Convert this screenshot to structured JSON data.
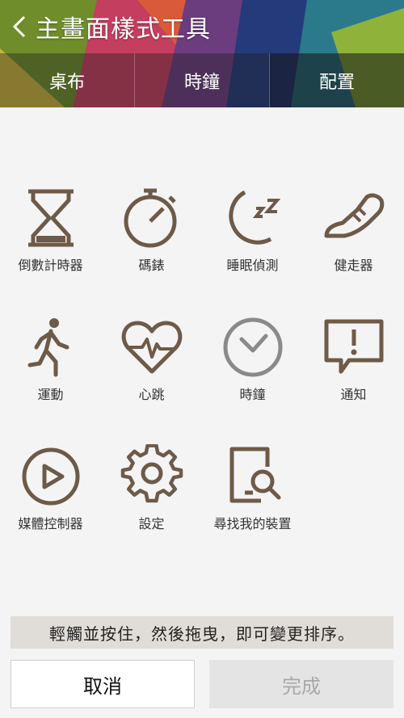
{
  "header": {
    "title": "主畫面樣式工具"
  },
  "tabs": [
    {
      "label": "桌布"
    },
    {
      "label": "時鐘"
    },
    {
      "label": "配置"
    }
  ],
  "widgets": [
    {
      "label": "倒數計時器",
      "icon": "hourglass-icon"
    },
    {
      "label": "碼錶",
      "icon": "stopwatch-icon"
    },
    {
      "label": "睡眠偵測",
      "icon": "moon-sleep-icon"
    },
    {
      "label": "健走器",
      "icon": "sneaker-icon"
    },
    {
      "label": "運動",
      "icon": "runner-icon"
    },
    {
      "label": "心跳",
      "icon": "heart-rate-icon"
    },
    {
      "label": "時鐘",
      "icon": "clock-icon"
    },
    {
      "label": "通知",
      "icon": "notification-icon"
    },
    {
      "label": "媒體控制器",
      "icon": "play-icon"
    },
    {
      "label": "設定",
      "icon": "gear-icon"
    },
    {
      "label": "尋找我的裝置",
      "icon": "find-device-icon"
    }
  ],
  "hint": "輕觸並按住，然後拖曳，即可變更排序。",
  "buttons": {
    "cancel": "取消",
    "done": "完成"
  },
  "colors": {
    "icon_brown": "#6e5a48",
    "clock_gray": "#8a8a8a"
  }
}
